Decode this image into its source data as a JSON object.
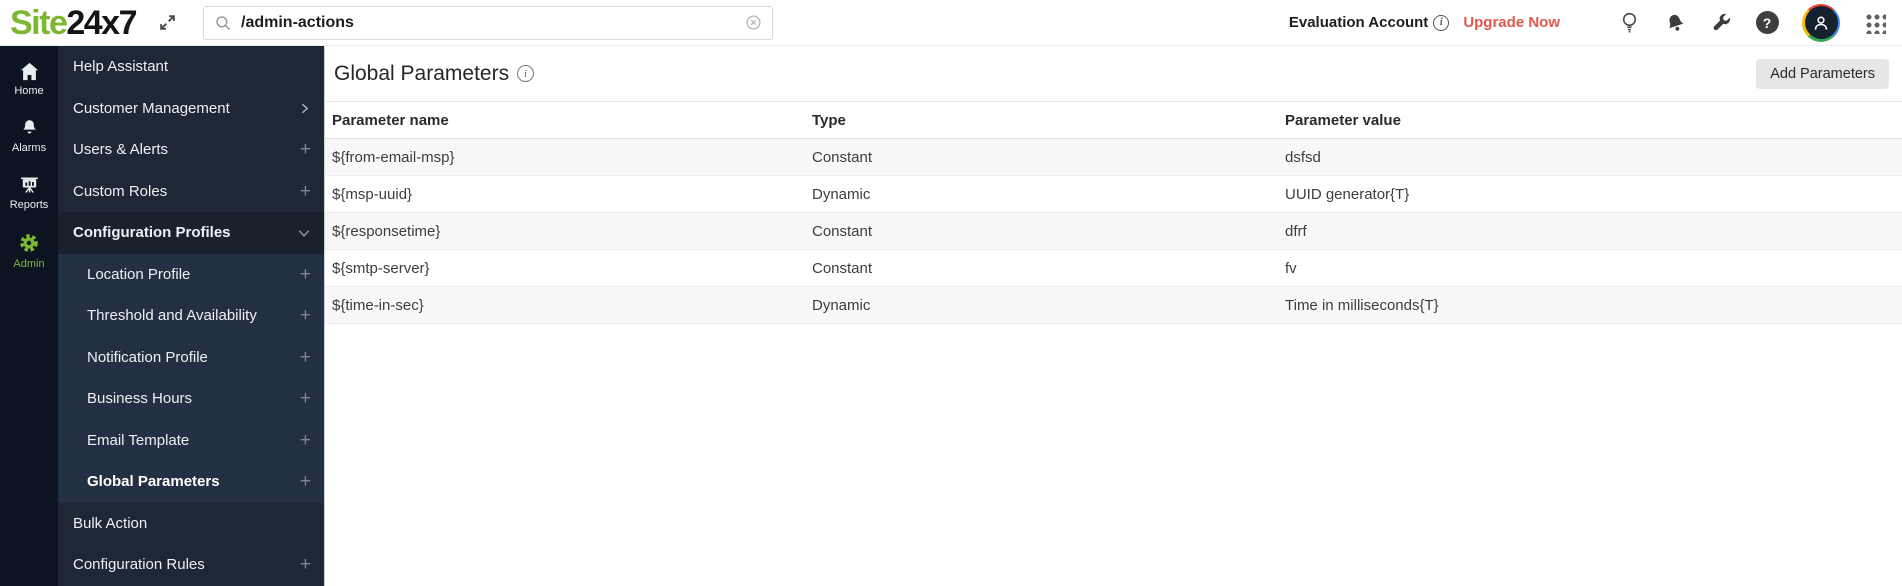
{
  "topbar": {
    "logo_part1": "Site",
    "logo_part2": "24x7",
    "search": {
      "value": "/admin-actions"
    },
    "account_label": "Evaluation Account",
    "account_info": "i",
    "upgrade_label": "Upgrade Now",
    "help_glyph": "?"
  },
  "rail": {
    "items": [
      {
        "label": "Home"
      },
      {
        "label": "Alarms"
      },
      {
        "label": "Reports"
      },
      {
        "label": "Admin"
      }
    ]
  },
  "sidebar": {
    "items": [
      {
        "label": "Help Assistant"
      },
      {
        "label": "Customer Management"
      },
      {
        "label": "Users & Alerts"
      },
      {
        "label": "Custom Roles"
      },
      {
        "label": "Configuration Profiles"
      },
      {
        "label": "Location Profile"
      },
      {
        "label": "Threshold and Availability"
      },
      {
        "label": "Notification Profile"
      },
      {
        "label": "Business Hours"
      },
      {
        "label": "Email Template"
      },
      {
        "label": "Global Parameters"
      },
      {
        "label": "Bulk Action"
      },
      {
        "label": "Configuration Rules"
      }
    ],
    "plus_glyph": "+"
  },
  "main": {
    "title": "Global Parameters",
    "title_info": "i",
    "add_button": "Add Parameters",
    "table": {
      "headers": [
        "Parameter name",
        "Type",
        "Parameter value"
      ],
      "rows": [
        {
          "name": "${from-email-msp}",
          "type": "Constant",
          "value": "dsfsd"
        },
        {
          "name": "${msp-uuid}",
          "type": "Dynamic",
          "value": "UUID generator{T}"
        },
        {
          "name": "${responsetime}",
          "type": "Constant",
          "value": "dfrf"
        },
        {
          "name": "${smtp-server}",
          "type": "Constant",
          "value": "fv"
        },
        {
          "name": "${time-in-sec}",
          "type": "Dynamic",
          "value": "Time in milliseconds{T}"
        }
      ]
    }
  },
  "colors": {
    "brand_green": "#7cb82f",
    "upgrade_red": "#e1584d",
    "rail_bg": "#0b1420",
    "menu_bg": "#1d2735",
    "submenu_bg": "#232f42"
  }
}
